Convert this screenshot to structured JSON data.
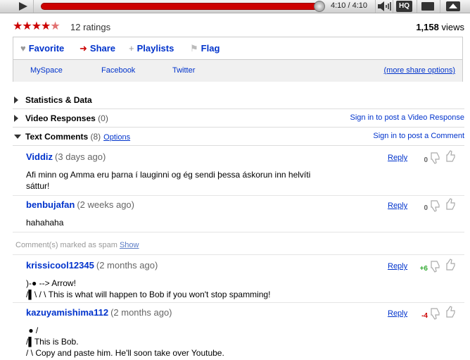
{
  "player": {
    "time": "4:10 / 4:10",
    "hq_label": "HQ"
  },
  "rating": {
    "ratings_text": "12 ratings",
    "views_count": "1,158",
    "views_label": "views"
  },
  "actions": {
    "favorite": "Favorite",
    "share": "Share",
    "playlists": "Playlists",
    "flag": "Flag"
  },
  "share": {
    "myspace": "MySpace",
    "facebook": "Facebook",
    "twitter": "Twitter",
    "more": "(more share options)"
  },
  "sections": {
    "stats": "Statistics & Data",
    "video_responses": "Video Responses",
    "video_responses_count": "(0)",
    "video_responses_link": "Sign in to post a Video Response",
    "text_comments": "Text Comments",
    "text_comments_count": "(8)",
    "options": "Options",
    "text_comments_link": "Sign in to post a Comment"
  },
  "comments": [
    {
      "author": "Viddiz",
      "age": "(3 days ago)",
      "reply": "Reply",
      "score": "0",
      "body": "Afi minn og Amma eru þarna í lauginni og ég sendi þessa áskorun inn helvíti\nsáttur!"
    },
    {
      "author": "benbujafan",
      "age": "(2 weeks ago)",
      "reply": "Reply",
      "score": "0",
      "body": "hahahaha"
    },
    {
      "author": "krissicool12345",
      "age": "(2 months ago)",
      "reply": "Reply",
      "score": "+6",
      "body": ")-● --> Arrow!\n/▌\\ / \\ This is what will happen to Bob if you won't stop spamming!"
    },
    {
      "author": "kazuyamishima112",
      "age": "(2 months ago)",
      "reply": "Reply",
      "score": "-4",
      "body": " ● /\n/▌This is Bob.\n/ \\ Copy and paste him. He'll soon take over Youtube."
    }
  ],
  "spam": {
    "text": "Comment(s) marked as spam",
    "show": "Show"
  },
  "colors": {
    "link": "#0033cc",
    "star": "#cc0000",
    "progress": "#cc0000",
    "positive": "#33aa33",
    "negative": "#cc0000"
  }
}
